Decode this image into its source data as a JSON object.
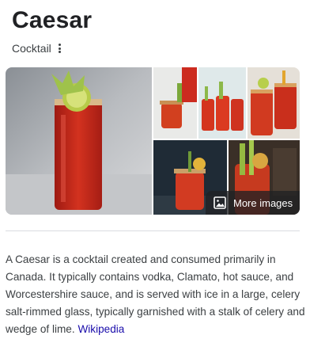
{
  "header": {
    "title": "Caesar",
    "subtitle": "Cocktail"
  },
  "gallery": {
    "more_images_label": "More images",
    "tiles": [
      {
        "name": "caesar-main-photo"
      },
      {
        "name": "caesar-photo-2"
      },
      {
        "name": "caesar-photo-3"
      },
      {
        "name": "caesar-photo-4"
      },
      {
        "name": "caesar-photo-5"
      },
      {
        "name": "caesar-photo-6"
      }
    ]
  },
  "description": {
    "text": "A Caesar is a cocktail created and consumed primarily in Canada. It typically contains vodka, Clamato, hot sauce, and Worcestershire sauce, and is served with ice in a large, celery salt-rimmed glass, typically garnished with a stalk of celery and wedge of lime.",
    "source_link": "Wikipedia"
  },
  "colors": {
    "drink_red": "#c7261c",
    "link_blue": "#1a0dab",
    "text": "#202124"
  }
}
